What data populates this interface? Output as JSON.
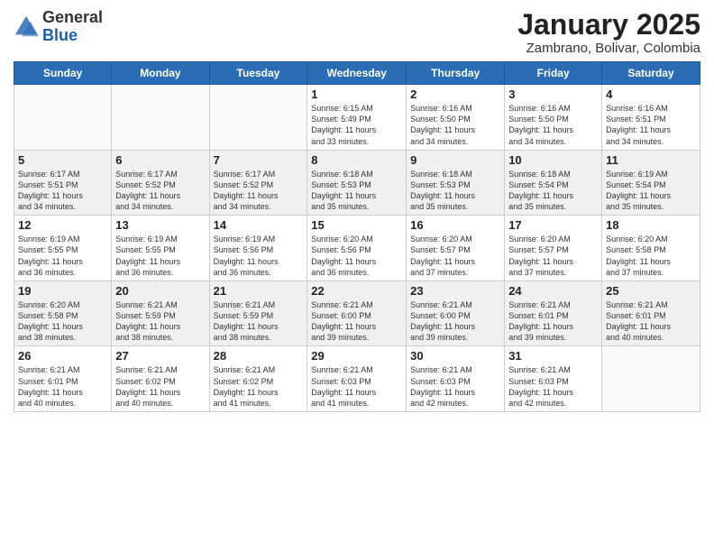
{
  "header": {
    "logo_general": "General",
    "logo_blue": "Blue",
    "month_title": "January 2025",
    "location": "Zambrano, Bolivar, Colombia"
  },
  "days_of_week": [
    "Sunday",
    "Monday",
    "Tuesday",
    "Wednesday",
    "Thursday",
    "Friday",
    "Saturday"
  ],
  "weeks": [
    {
      "shaded": false,
      "days": [
        {
          "date": "",
          "info": ""
        },
        {
          "date": "",
          "info": ""
        },
        {
          "date": "",
          "info": ""
        },
        {
          "date": "1",
          "info": "Sunrise: 6:15 AM\nSunset: 5:49 PM\nDaylight: 11 hours\nand 33 minutes."
        },
        {
          "date": "2",
          "info": "Sunrise: 6:16 AM\nSunset: 5:50 PM\nDaylight: 11 hours\nand 34 minutes."
        },
        {
          "date": "3",
          "info": "Sunrise: 6:16 AM\nSunset: 5:50 PM\nDaylight: 11 hours\nand 34 minutes."
        },
        {
          "date": "4",
          "info": "Sunrise: 6:16 AM\nSunset: 5:51 PM\nDaylight: 11 hours\nand 34 minutes."
        }
      ]
    },
    {
      "shaded": true,
      "days": [
        {
          "date": "5",
          "info": "Sunrise: 6:17 AM\nSunset: 5:51 PM\nDaylight: 11 hours\nand 34 minutes."
        },
        {
          "date": "6",
          "info": "Sunrise: 6:17 AM\nSunset: 5:52 PM\nDaylight: 11 hours\nand 34 minutes."
        },
        {
          "date": "7",
          "info": "Sunrise: 6:17 AM\nSunset: 5:52 PM\nDaylight: 11 hours\nand 34 minutes."
        },
        {
          "date": "8",
          "info": "Sunrise: 6:18 AM\nSunset: 5:53 PM\nDaylight: 11 hours\nand 35 minutes."
        },
        {
          "date": "9",
          "info": "Sunrise: 6:18 AM\nSunset: 5:53 PM\nDaylight: 11 hours\nand 35 minutes."
        },
        {
          "date": "10",
          "info": "Sunrise: 6:18 AM\nSunset: 5:54 PM\nDaylight: 11 hours\nand 35 minutes."
        },
        {
          "date": "11",
          "info": "Sunrise: 6:19 AM\nSunset: 5:54 PM\nDaylight: 11 hours\nand 35 minutes."
        }
      ]
    },
    {
      "shaded": false,
      "days": [
        {
          "date": "12",
          "info": "Sunrise: 6:19 AM\nSunset: 5:55 PM\nDaylight: 11 hours\nand 36 minutes."
        },
        {
          "date": "13",
          "info": "Sunrise: 6:19 AM\nSunset: 5:55 PM\nDaylight: 11 hours\nand 36 minutes."
        },
        {
          "date": "14",
          "info": "Sunrise: 6:19 AM\nSunset: 5:56 PM\nDaylight: 11 hours\nand 36 minutes."
        },
        {
          "date": "15",
          "info": "Sunrise: 6:20 AM\nSunset: 5:56 PM\nDaylight: 11 hours\nand 36 minutes."
        },
        {
          "date": "16",
          "info": "Sunrise: 6:20 AM\nSunset: 5:57 PM\nDaylight: 11 hours\nand 37 minutes."
        },
        {
          "date": "17",
          "info": "Sunrise: 6:20 AM\nSunset: 5:57 PM\nDaylight: 11 hours\nand 37 minutes."
        },
        {
          "date": "18",
          "info": "Sunrise: 6:20 AM\nSunset: 5:58 PM\nDaylight: 11 hours\nand 37 minutes."
        }
      ]
    },
    {
      "shaded": true,
      "days": [
        {
          "date": "19",
          "info": "Sunrise: 6:20 AM\nSunset: 5:58 PM\nDaylight: 11 hours\nand 38 minutes."
        },
        {
          "date": "20",
          "info": "Sunrise: 6:21 AM\nSunset: 5:59 PM\nDaylight: 11 hours\nand 38 minutes."
        },
        {
          "date": "21",
          "info": "Sunrise: 6:21 AM\nSunset: 5:59 PM\nDaylight: 11 hours\nand 38 minutes."
        },
        {
          "date": "22",
          "info": "Sunrise: 6:21 AM\nSunset: 6:00 PM\nDaylight: 11 hours\nand 39 minutes."
        },
        {
          "date": "23",
          "info": "Sunrise: 6:21 AM\nSunset: 6:00 PM\nDaylight: 11 hours\nand 39 minutes."
        },
        {
          "date": "24",
          "info": "Sunrise: 6:21 AM\nSunset: 6:01 PM\nDaylight: 11 hours\nand 39 minutes."
        },
        {
          "date": "25",
          "info": "Sunrise: 6:21 AM\nSunset: 6:01 PM\nDaylight: 11 hours\nand 40 minutes."
        }
      ]
    },
    {
      "shaded": false,
      "days": [
        {
          "date": "26",
          "info": "Sunrise: 6:21 AM\nSunset: 6:01 PM\nDaylight: 11 hours\nand 40 minutes."
        },
        {
          "date": "27",
          "info": "Sunrise: 6:21 AM\nSunset: 6:02 PM\nDaylight: 11 hours\nand 40 minutes."
        },
        {
          "date": "28",
          "info": "Sunrise: 6:21 AM\nSunset: 6:02 PM\nDaylight: 11 hours\nand 41 minutes."
        },
        {
          "date": "29",
          "info": "Sunrise: 6:21 AM\nSunset: 6:03 PM\nDaylight: 11 hours\nand 41 minutes."
        },
        {
          "date": "30",
          "info": "Sunrise: 6:21 AM\nSunset: 6:03 PM\nDaylight: 11 hours\nand 42 minutes."
        },
        {
          "date": "31",
          "info": "Sunrise: 6:21 AM\nSunset: 6:03 PM\nDaylight: 11 hours\nand 42 minutes."
        },
        {
          "date": "",
          "info": ""
        }
      ]
    }
  ]
}
